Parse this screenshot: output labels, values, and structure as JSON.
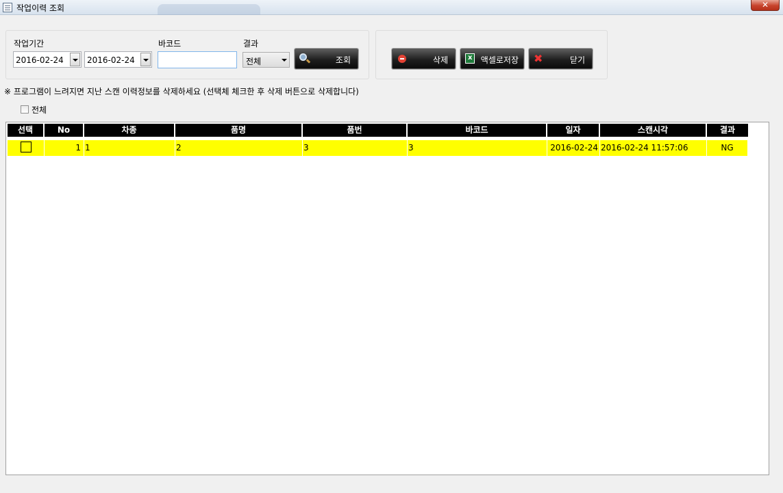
{
  "window": {
    "title": "작업이력 조회",
    "close_label": "✕"
  },
  "filters": {
    "period_label": "작업기간",
    "date_from": "2016-02-24",
    "date_to": "2016-02-24",
    "barcode_label": "바코드",
    "barcode_value": "",
    "result_label": "결과",
    "result_selected": "전체",
    "search_button": "조회"
  },
  "actions": {
    "delete_button": "삭제",
    "excel_button": "액셀로저장",
    "close_button": "닫기"
  },
  "notice": "※ 프로그램이 느려지면 지난 스캔 이력정보를 삭제하세요 (선택체 체크한 후 삭제 버튼으로 삭제합니다)",
  "select_all_label": "전체",
  "table": {
    "columns": [
      "선택",
      "No",
      "차종",
      "품명",
      "품번",
      "바코드",
      "일자",
      "스캔시각",
      "결과"
    ],
    "rows": [
      {
        "no": "1",
        "car_type": "1",
        "item_name": "2",
        "item_no": "3",
        "barcode": "3",
        "date": "2016-02-24",
        "scan_time": "2016-02-24 11:57:06",
        "result": "NG"
      }
    ]
  },
  "colors": {
    "row_highlight": "#ffff00",
    "header_bg": "#000000",
    "header_text": "#ffffff"
  },
  "icons": [
    "menu-icon",
    "search-icon",
    "delete-icon",
    "excel-icon",
    "close-x-icon",
    "chevron-down-icon"
  ]
}
